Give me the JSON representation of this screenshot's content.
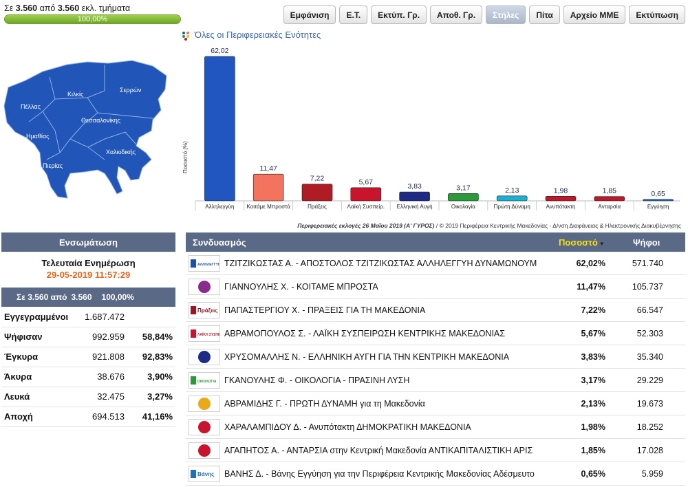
{
  "top": {
    "prefix": "Σε",
    "counted": "3.560",
    "from": "από",
    "total": "3.560",
    "suffix": "εκλ. τμήματα",
    "progress_text": "100,00%",
    "progress_value": 1.0
  },
  "toolbar": {
    "buttons": [
      {
        "label": "Εμφάνιση",
        "active": false
      },
      {
        "label": "Ε.Τ.",
        "active": false
      },
      {
        "label": "Εκτύπ. Γρ.",
        "active": false
      },
      {
        "label": "Αποθ. Γρ.",
        "active": false
      },
      {
        "label": "Στήλες",
        "active": true
      },
      {
        "label": "Πίτα",
        "active": false
      },
      {
        "label": "Αρχείο ΜΜΕ",
        "active": false
      },
      {
        "label": "Εκτύπωση",
        "active": false
      }
    ]
  },
  "map": {
    "labels": [
      "Πέλλας",
      "Κιλκίς",
      "Σερρών",
      "Θεσσαλονίκης",
      "Ημαθίας",
      "Χαλκιδικής",
      "Πιερίας"
    ],
    "fill_color": "#2255b8"
  },
  "chart_title": "Όλες οι Περιφερειακές Ενότητες",
  "chart_data": {
    "type": "bar",
    "ylabel": "Ποσοστό (%)",
    "categories": [
      "Αλληλεγγύη",
      "Κοιτάμε Μπροστά",
      "Πράξεις",
      "Λαϊκή Συσπείρ.",
      "Ελληνική Αυγή",
      "Οικολογία",
      "Πρώτη Δύναμη",
      "Ανυπότακτη",
      "Ανταρσία",
      "Εγγύηση"
    ],
    "values": [
      62.02,
      11.47,
      7.22,
      5.67,
      3.83,
      3.17,
      2.13,
      1.98,
      1.85,
      0.65
    ],
    "value_labels": [
      "62,02",
      "11,47",
      "7,22",
      "5,67",
      "3,83",
      "3,17",
      "2,13",
      "1,98",
      "1,85",
      "0,65"
    ],
    "colors": [
      "#2156c0",
      "#f4735f",
      "#b01c26",
      "#c8142c",
      "#1e2a86",
      "#2c9a3a",
      "#1ab0d0",
      "#c01828",
      "#c01828",
      "#1f6fb8"
    ]
  },
  "footer": {
    "bold": "Περιφερειακές εκλογές 26 Μαΐου 2019 (Α' ΓΥΡΟΣ)",
    "rest": " / © 2019 Περιφέρεια Κεντρικής Μακεδονίας - Δ/νση Διαφάνειας & Ηλεκτρονικής Διακυβέρνησης"
  },
  "left": {
    "header": "Ενσωμάτωση",
    "update_title": "Τελευταία Ενημέρωση",
    "update_date": "29-05-2019 11:57:29",
    "summary": [
      "Σε 3.560 από",
      "3.560",
      "100,00%"
    ],
    "stats": [
      {
        "label": "Εγγεγραμμένοι",
        "value": "1.687.472",
        "pct": ""
      },
      {
        "label": "Ψήφισαν",
        "value": "992.959",
        "pct": "58,84%"
      },
      {
        "label": "Έγκυρα",
        "value": "921.808",
        "pct": "92,83%"
      },
      {
        "label": "Άκυρα",
        "value": "38.676",
        "pct": "3,90%"
      },
      {
        "label": "Λευκά",
        "value": "32.475",
        "pct": "3,27%"
      },
      {
        "label": "Αποχή",
        "value": "694.513",
        "pct": "41,16%"
      }
    ]
  },
  "table": {
    "col_name": "Συνδυασμός",
    "col_pct": "Ποσοστό",
    "col_votes": "Ψήφοι",
    "rows": [
      {
        "name": "ΤΖΙΤΖΙΚΩΣΤΑΣ Α. - ΑΠΟΣΤΟΛΟΣ ΤΖΙΤΖΙΚΩΣΤΑΣ ΑΛΛΗΛΕΓΓΥΗ ΔΥΝΑΜΩΝΟΥΜ",
        "pct": "62,02%",
        "votes": "571.740",
        "logo": "ΑΛΛΗΛΕΓΓΥΗ",
        "logo_color": "#1d4fa8"
      },
      {
        "name": "ΓΙΑΝΝΟΥΛΗΣ Χ. - ΚΟΙΤΑΜΕ ΜΠΡΟΣΤΑ",
        "pct": "11,47%",
        "votes": "105.737",
        "logo": "",
        "logo_color": "#8a2a8a"
      },
      {
        "name": "ΠΑΠΑΣΤΕΡΓΙΟΥ Χ. - ΠΡΑΞΕΙΣ ΓΙΑ ΤΗ ΜΑΚΕΔΟΝΙΑ",
        "pct": "7,22%",
        "votes": "66.547",
        "logo": "Πράξεις",
        "logo_color": "#9b1622"
      },
      {
        "name": "ΑΒΡΑΜΟΠΟΥΛΟΣ Σ. - ΛΑΪΚΗ ΣΥΣΠΕΙΡΩΣΗ ΚΕΝΤΡΙΚΗΣ ΜΑΚΕΔΟΝΙΑΣ",
        "pct": "5,67%",
        "votes": "52.303",
        "logo": "ΛΑΪΚΗ ΣΥΣΠΕΙΡΩΣΗ",
        "logo_color": "#c8142c"
      },
      {
        "name": "ΧΡΥΣΟΜΑΛΛΗΣ Ν. - ΕΛΛΗΝΙΚΗ ΑΥΓΗ ΓΙΑ ΤΗΝ ΚΕΝΤΡΙΚΗ ΜΑΚΕΔΟΝΙΑ",
        "pct": "3,83%",
        "votes": "35.340",
        "logo": "",
        "logo_color": "#1e2a86"
      },
      {
        "name": "ΓΚΑΝΟΥΛΗΣ Φ. - ΟΙΚΟΛΟΓΙΑ - ΠΡΑΣΙΝΗ ΛΥΣΗ",
        "pct": "3,17%",
        "votes": "29.229",
        "logo": "ΟΙΚΟΛΟΓΙΑ",
        "logo_color": "#2c9a3a"
      },
      {
        "name": "ΑΒΡΑΜΙΔΗΣ Γ. - ΠΡΩΤΗ ΔΥΝΑΜΗ για τη Μακεδονία",
        "pct": "2,13%",
        "votes": "19.673",
        "logo": "",
        "logo_color": "#e9a91a"
      },
      {
        "name": "ΧΑΡΑΛΑΜΠΙΔΟΥ Δ. - Ανυπότακτη ΔΗΜΟΚΡΑΤΙΚΗ ΜΑΚΕΔΟΝΙΑ",
        "pct": "1,98%",
        "votes": "18.252",
        "logo": "",
        "logo_color": "#c8142c"
      },
      {
        "name": "ΑΓΑΠΗΤΟΣ Α. - ΑΝΤΑΡΣΙΑ στην Κεντρική Μακεδονία ΑΝΤΙΚΑΠΙΤΑΛΙΣΤΙΚΗ ΑΡΙΣ",
        "pct": "1,85%",
        "votes": "17.028",
        "logo": "",
        "logo_color": "#c8142c"
      },
      {
        "name": "ΒΑΝΗΣ Δ. - Βάνης Εγγύηση για την Περιφέρεια Κεντρικής Μακεδονίας Αδέσμευτο",
        "pct": "0,65%",
        "votes": "5.959",
        "logo": "Βάνης",
        "logo_color": "#1f6fb8"
      }
    ]
  }
}
